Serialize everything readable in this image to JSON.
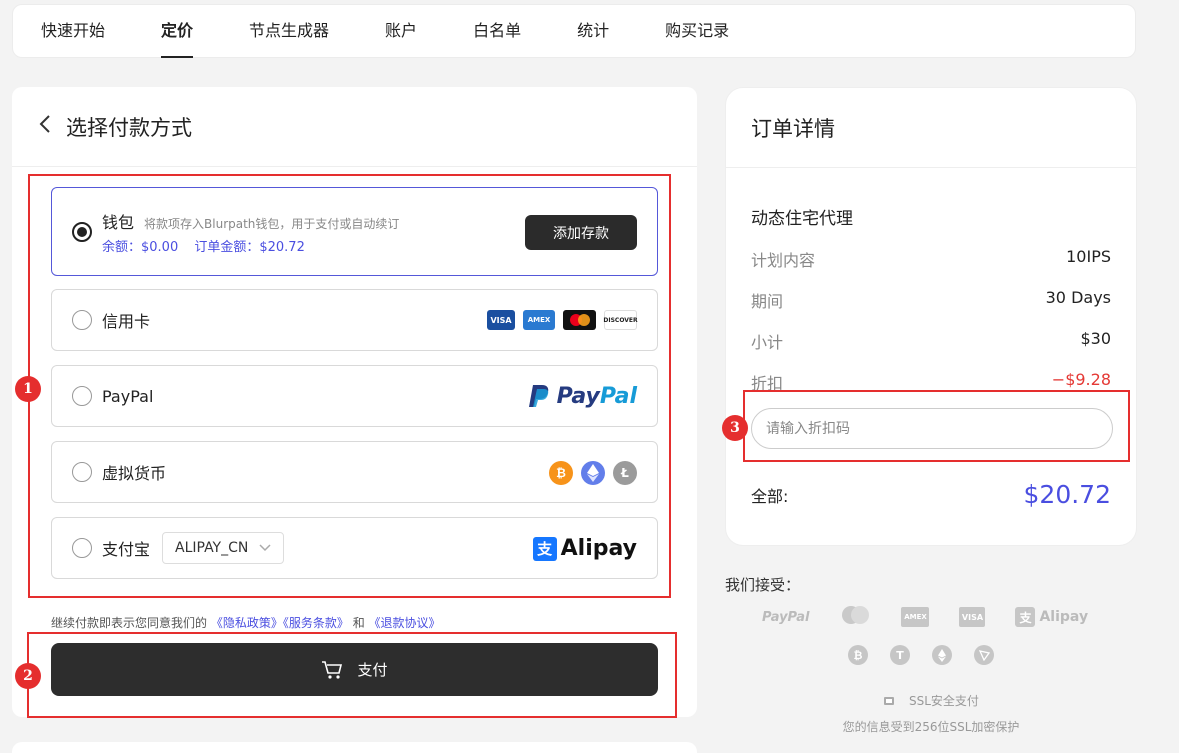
{
  "nav": {
    "tabs": [
      {
        "label": "快速开始"
      },
      {
        "label": "定价"
      },
      {
        "label": "节点生成器"
      },
      {
        "label": "账户"
      },
      {
        "label": "白名单"
      },
      {
        "label": "统计"
      },
      {
        "label": "购买记录"
      }
    ],
    "active_index": 1
  },
  "payment": {
    "title": "选择付款方式",
    "back_icon": "chevron-left-icon",
    "selected": "wallet",
    "wallet": {
      "label": "钱包",
      "description": "将款项存入Blurpath钱包，用于支付或自动续订",
      "balance": "余额：$0.00",
      "order_amount": "订单金额：$20.72",
      "button": "添加存款"
    },
    "credit_card": {
      "label": "信用卡",
      "brands": [
        "VISA",
        "AMEX",
        "mastercard",
        "DISCOVER"
      ]
    },
    "paypal": {
      "label": "PayPal",
      "logo_p1": "Pay",
      "logo_p2": "Pal"
    },
    "crypto": {
      "label": "虚拟货币",
      "coins": [
        "bitcoin-icon",
        "ethereum-icon",
        "litecoin-icon"
      ]
    },
    "alipay": {
      "label": "支付宝",
      "select_value": "ALIPAY_CN",
      "logo_text": "Alipay",
      "logo_char": "支"
    },
    "agreement": {
      "prefix": "继续付款即表示您同意我们的",
      "privacy": "《隐私政策》",
      "terms": "《服务条款》",
      "and": "和",
      "refund": "《退款协议》"
    },
    "pay_button": "支付"
  },
  "annotations": [
    "1",
    "2",
    "3"
  ],
  "order": {
    "title": "订单详情",
    "plan_name": "动态住宅代理",
    "rows": [
      {
        "key": "计划内容",
        "value": "10IPS"
      },
      {
        "key": "期间",
        "value": "30 Days"
      },
      {
        "key": "小计",
        "value": "$30"
      },
      {
        "key": "折扣",
        "value": "−$9.28"
      }
    ],
    "discount_placeholder": "请输入折扣码",
    "total_label": "全部:",
    "total_value": "$20.72"
  },
  "accepted": {
    "title": "我们接受：",
    "row1": [
      "PayPal",
      "mastercard",
      "AMEX",
      "VISA",
      "Alipay"
    ],
    "row2": [
      "bitcoin-icon",
      "tether-icon",
      "ethereum-icon",
      "tron-icon"
    ],
    "ssl_label": "SSL安全支付",
    "ssl_note": "您的信息受到256位SSL加密保护"
  },
  "colors": {
    "accent": "#4a4ee0",
    "annotation": "#e52e2e",
    "danger": "#e53935",
    "dark_button": "#2b2b2b"
  }
}
